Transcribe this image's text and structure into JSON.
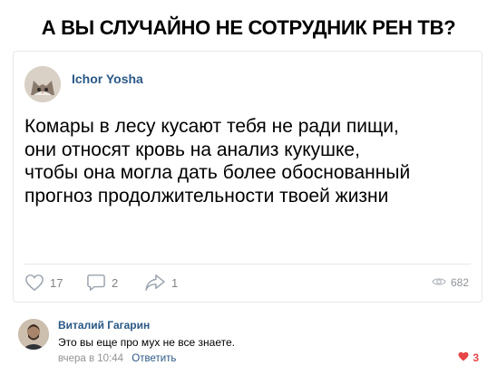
{
  "meme_title": "А ВЫ СЛУЧАЙНО НЕ СОТРУДНИК РЕН ТВ?",
  "post": {
    "author": "Ichor Yosha",
    "text": "Комары в лесу кусают тебя не ради пищи,\nони относят кровь на анализ кукушке,\nчтобы она могла дать более обоснованный\nпрогноз продолжительности твоей жизни",
    "likes": "17",
    "comments": "2",
    "shares": "1",
    "views": "682"
  },
  "comment": {
    "author": "Виталий Гагарин",
    "text": "Это вы еще про мух не все знаете.",
    "time": "вчера в 10:44",
    "reply_label": "Ответить",
    "likes": "3"
  },
  "colors": {
    "link": "#2a5885",
    "muted": "#828282",
    "like_active": "#e64646"
  },
  "icons": [
    "heart-icon",
    "comment-icon",
    "share-icon",
    "eye-icon"
  ]
}
